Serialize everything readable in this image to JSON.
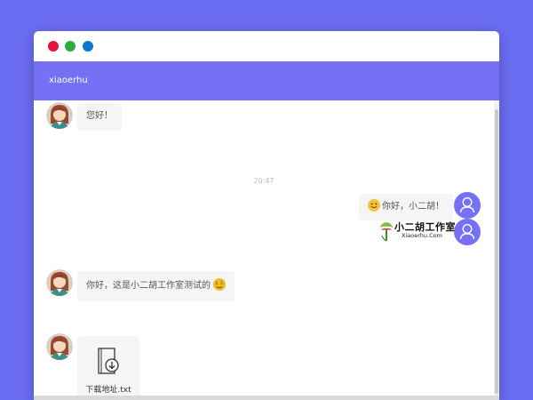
{
  "window": {
    "dots": [
      "red",
      "green",
      "blue"
    ]
  },
  "header": {
    "title": "xiaoerhu"
  },
  "messages": [
    {
      "side": "left",
      "type": "text",
      "text": "您好！"
    },
    {
      "type": "time",
      "text": "20:47"
    },
    {
      "side": "right",
      "type": "text",
      "text": "你好，小二胡！",
      "emoji": "smile-emoji"
    },
    {
      "side": "right",
      "type": "image",
      "logo_text": "小二胡工作室",
      "logo_sub": "Xiaoerhu.Com"
    },
    {
      "side": "left",
      "type": "text",
      "text": "你好，这是小二胡工作室测试的",
      "emoji": "money-face-emoji"
    },
    {
      "side": "left",
      "type": "file",
      "file_name": "下载地址.txt"
    }
  ],
  "colors": {
    "background": "#6b6df3",
    "header": "#7570f4",
    "bubble": "#f5f5f5",
    "user_avatar": "#7570f4"
  }
}
